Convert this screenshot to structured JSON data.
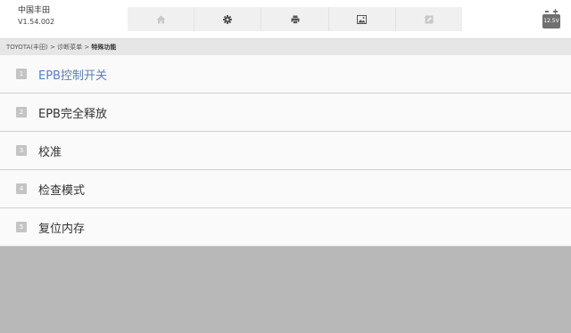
{
  "header": {
    "brand_name": "中国丰田",
    "version": "V1.54.002",
    "toolbar": [
      {
        "icon": "home-icon"
      },
      {
        "icon": "gear-icon"
      },
      {
        "icon": "printer-icon"
      },
      {
        "icon": "image-icon"
      },
      {
        "icon": "edit-icon"
      }
    ],
    "battery_voltage": "12.5V"
  },
  "breadcrumb": {
    "path": "TOYOTA(丰田) > 诊断菜单 > ",
    "current": "特殊功能"
  },
  "menu": {
    "selected_index": 0,
    "items": [
      {
        "num": "1",
        "label": "EPB控制开关"
      },
      {
        "num": "2",
        "label": "EPB完全释放"
      },
      {
        "num": "3",
        "label": "校准"
      },
      {
        "num": "4",
        "label": "检查模式"
      },
      {
        "num": "5",
        "label": "复位内存"
      }
    ]
  },
  "colors": {
    "selected_text": "#5b7fbf",
    "background": "#b8b8b8",
    "number_badge": "#c4c4c4"
  }
}
